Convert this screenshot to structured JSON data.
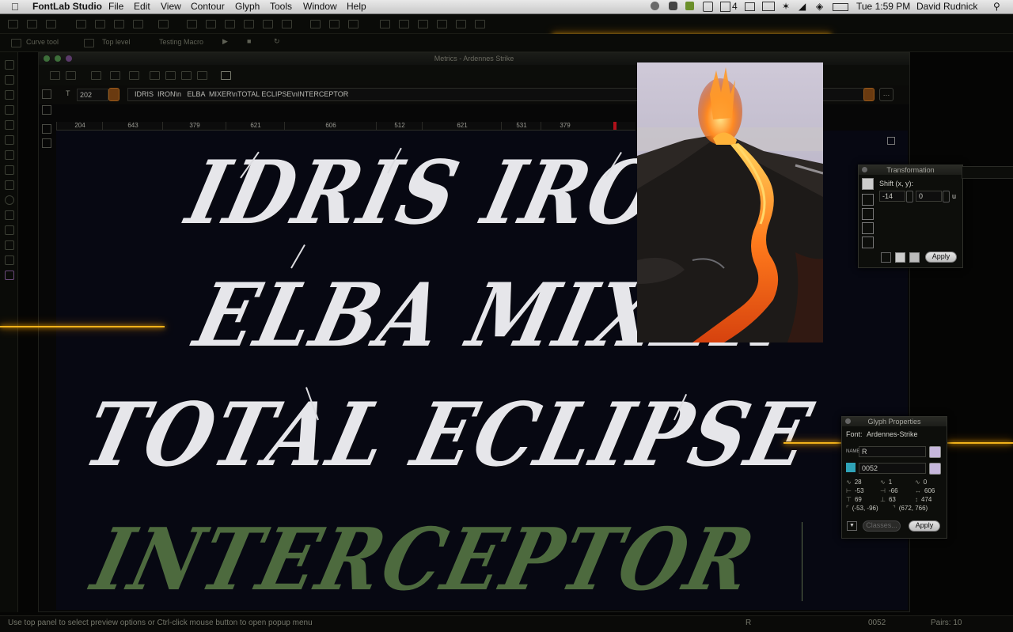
{
  "menubar": {
    "app_name": "FontLab Studio",
    "menus": [
      "File",
      "Edit",
      "View",
      "Contour",
      "Glyph",
      "Tools",
      "Window",
      "Help"
    ],
    "status_text": "4",
    "clock": "Tue 1:59 PM",
    "user": "David Rudnick"
  },
  "toolbar2": {
    "tool_label": "Curve tool",
    "level_label": "Top level",
    "macro_label": "Testing Macro"
  },
  "metrics_window": {
    "title": "Metrics - Ardennes Strike",
    "font_size": "202",
    "text_value": "IDRIS  IRON\\n   ELBA  MIXER\\nTOTAL ECLIPSE\\nINTERCEPTOR",
    "widths": [
      "204",
      "643",
      "379",
      "621",
      "606",
      "512",
      "621",
      "531",
      "379"
    ],
    "lines": [
      "IDRIS IRON",
      "ELBA MIXER",
      "TOTAL ECLIPSE",
      "INTERCEPTOR"
    ]
  },
  "transformation": {
    "title": "Transformation",
    "shift_label": "Shift (x, y):",
    "x_value": "-14",
    "y_value": "0",
    "unit": "u",
    "apply_label": "Apply"
  },
  "glyph_properties": {
    "title": "Glyph Properties",
    "font_label": "Font:",
    "font_name": "Ardennes-Strike",
    "name_tag": "NAME",
    "name_value": "R",
    "unicode_value": "0052",
    "metrics": [
      [
        "28",
        "1",
        "0"
      ],
      [
        "-53",
        "-66",
        "606"
      ],
      [
        "69",
        "63",
        "474"
      ],
      [
        "(-53, -96)",
        "(672, 766)"
      ]
    ],
    "classes_label": "Classes...",
    "apply_label": "Apply"
  },
  "statusbar": {
    "message": "Use top panel to select preview options or Ctrl-click mouse button to open popup menu",
    "glyph": "R",
    "code": "0052",
    "pairs": "Pairs: 10"
  },
  "colors": {
    "accent_glow": "#f2b21b",
    "canvas_bg": "#070812",
    "glyph_fill": "#e6e6ea",
    "ghost_glyph": "#4d6a3e"
  }
}
